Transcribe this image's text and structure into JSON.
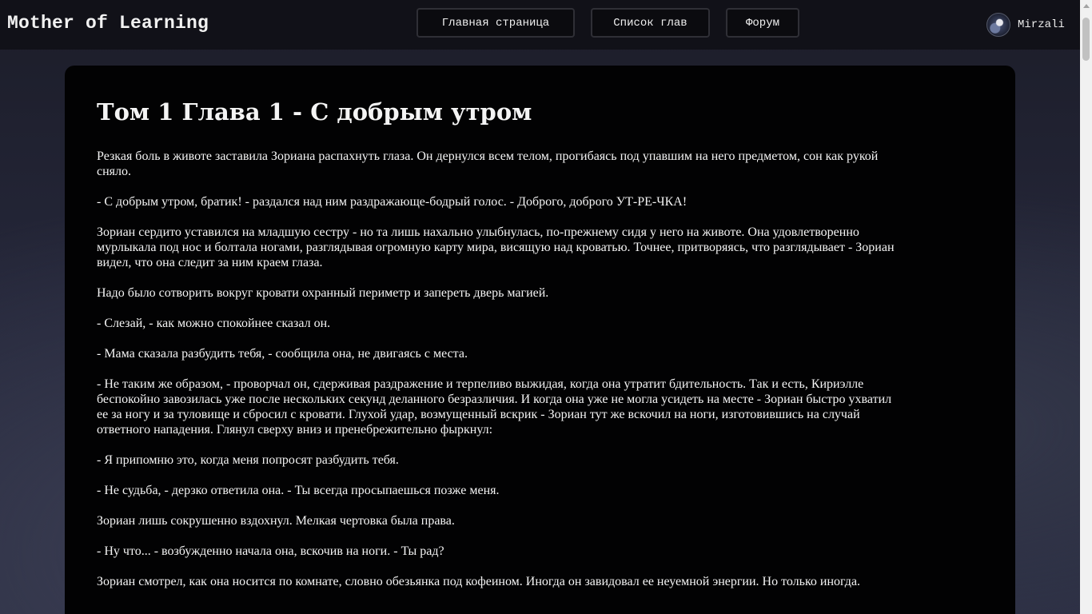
{
  "header": {
    "site_title": "Mother of Learning",
    "nav": {
      "home": "Главная страница",
      "chapters": "Список глав",
      "forum": "Форум"
    },
    "user": {
      "name": "Mirzali",
      "avatar_icon": "user-avatar-icon"
    }
  },
  "chapter": {
    "title": "Том 1 Глава 1 - С добрым утром",
    "paragraphs": [
      "Резкая боль в животе заставила Зориана распахнуть глаза. Он дернулся всем телом, прогибаясь под упавшим на него предметом, сон как рукой сняло.",
      "- С добрым утром, братик! - раздался над ним раздражающе-бодрый голос. - Доброго, доброго УТ-РЕ-ЧКА!",
      "Зориан сердито уставился на младшую сестру - но та лишь нахально улыбнулась, по-прежнему сидя у него на животе. Она удовлетворенно мурлыкала под нос и болтала ногами, разглядывая огромную карту мира, висящую над кроватью. Точнее, притворяясь, что разглядывает - Зориан видел, что она следит за ним краем глаза.",
      "Надо было сотворить вокруг кровати охранный периметр и запереть дверь магией.",
      "- Слезай, - как можно спокойнее сказал он.",
      "- Мама сказала разбудить тебя, - сообщила она, не двигаясь с места.",
      "- Не таким же образом, - проворчал он, сдерживая раздражение и терпеливо выжидая, когда она утратит бдительность. Так и есть, Кириэлле беспокойно завозилась уже после нескольких секунд деланного безразличия. И когда она уже не могла усидеть на месте - Зориан быстро ухватил ее за ногу и за туловище и сбросил с кровати. Глухой удар, возмущенный вскрик - Зориан тут же вскочил на ноги, изготовившись на случай ответного нападения. Глянул сверху вниз и пренебрежительно фыркнул:",
      "- Я припомню это, когда меня попросят разбудить тебя.",
      "- Не судьба, - дерзко ответила она. - Ты всегда просыпаешься позже меня.",
      "Зориан лишь сокрушенно вздохнул. Мелкая чертовка была права.",
      "- Ну что... - возбужденно начала она, вскочив на ноги. - Ты рад?",
      "Зориан смотрел, как она носится по комнате, словно обезьянка под кофеином. Иногда он завидовал ее неуемной энергии. Но только иногда."
    ]
  },
  "colors": {
    "topbar_bg": "#111118",
    "content_bg": "#020203",
    "text": "#f4f4f4",
    "nav_border": "#2f2f36"
  }
}
